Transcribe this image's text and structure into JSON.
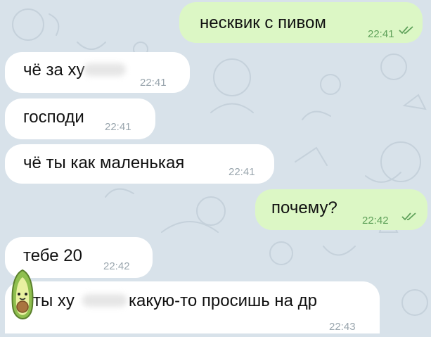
{
  "colors": {
    "background": "#d8e2ea",
    "incoming_bubble": "#ffffff",
    "outgoing_bubble": "#dcf7c5",
    "outgoing_time": "#5fa15a",
    "incoming_time": "#9aa6ae"
  },
  "messages": [
    {
      "direction": "out",
      "text": "несквик с пивом",
      "time": "22:41",
      "status": "double-check-icon"
    },
    {
      "direction": "in",
      "text": "чё за ху",
      "time": "22:41",
      "censored": true
    },
    {
      "direction": "in",
      "text": "господи",
      "time": "22:41"
    },
    {
      "direction": "in",
      "text": "чё ты как маленькая",
      "time": "22:41"
    },
    {
      "direction": "out",
      "text": "почему?",
      "time": "22:42",
      "status": "double-check-icon"
    },
    {
      "direction": "in",
      "text": "тебе 20",
      "time": "22:42"
    },
    {
      "direction": "in",
      "text_before": "а ты ху",
      "text_after": "какую-то просишь на др",
      "time": "22:43",
      "censored": true,
      "avatar": "avocado-sticker-icon"
    }
  ]
}
